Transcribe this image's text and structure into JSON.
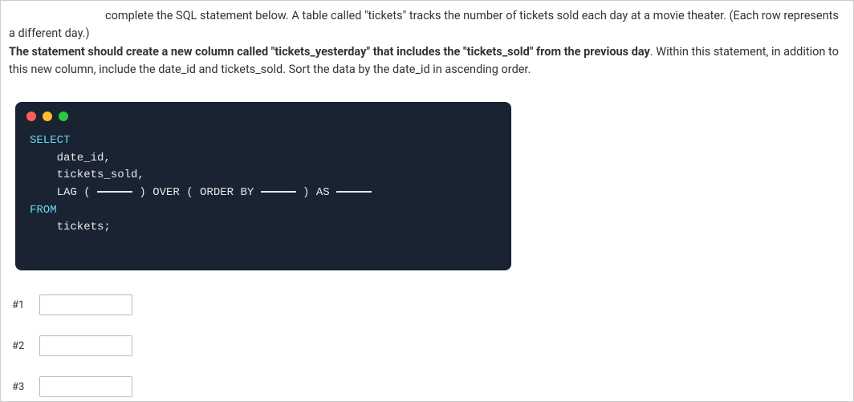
{
  "instruction": {
    "part1": "complete the SQL statement below.  A table called \"tickets\" tracks the number of tickets sold each day at a movie theater.  (Each row represents a different day.)  ",
    "bold": "The statement should create a new column called \"tickets_yesterday\" that includes the \"tickets_sold\" from the previous day",
    "part2": ".  Within this statement, in addition to this new column, include the date_id and tickets_sold.  Sort the data by the date_id in ascending order."
  },
  "code": {
    "line1": "SELECT",
    "line2": "    date_id,",
    "line3": "    tickets_sold,",
    "line4a": "    LAG ( ",
    "line4b": " ) OVER ( ORDER BY ",
    "line4c": " ) AS ",
    "line5": "FROM",
    "line6": "    tickets;"
  },
  "answers": {
    "label1": "#1",
    "label2": "#2",
    "label3": "#3",
    "value1": "",
    "value2": "",
    "value3": ""
  }
}
